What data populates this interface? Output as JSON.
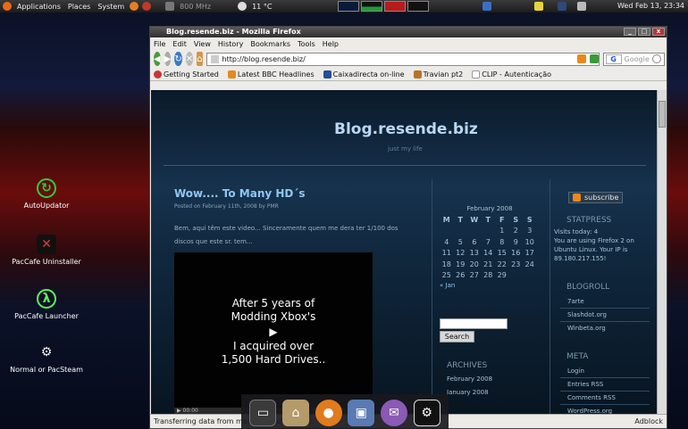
{
  "panel": {
    "applications": "Applications",
    "places": "Places",
    "system": "System",
    "cpu": "800 MHz",
    "temperature": "11 °C",
    "clock": "Wed Feb 13, 23:34"
  },
  "desktop": {
    "icons": [
      {
        "label": "AutoUpdator",
        "icon": "autoupdator-icon"
      },
      {
        "label": "PacCafe Uninstaller",
        "icon": "pacman-uninstall-icon"
      },
      {
        "label": "PacCafe Launcher",
        "icon": "lambda-launcher-icon"
      },
      {
        "label": "Normal or PacSteam",
        "icon": "steam-icon"
      }
    ]
  },
  "window": {
    "title": "Blog.resende.biz - Mozilla Firefox",
    "menu": [
      "File",
      "Edit",
      "View",
      "History",
      "Bookmarks",
      "Tools",
      "Help"
    ],
    "url": "http://blog.resende.biz/",
    "search_placeholder": "Google",
    "bookmarks": [
      "Getting Started",
      "Latest BBC Headlines",
      "Caixadirecta on-line",
      "Travian pt2",
      "CLIP - Autenticação"
    ],
    "status": "Transferring data from media.youtube.com...",
    "adblock": "Adblock"
  },
  "blog": {
    "title": "Blog.resende.biz",
    "tagline": "just my life",
    "post": {
      "title": "Wow.... To Many HD´s",
      "meta": "Posted on February 11th, 2008 by PMR",
      "body": "Bem, aqui têm este video... Sinceramente quem me dera ter 1/100 dos discos que este sr. tem...",
      "video_lines": [
        "After 5 years of",
        "Modding Xbox's",
        "I acquired over",
        "1,500 Hard Drives.."
      ],
      "video_controls": "00:00"
    },
    "calendar": {
      "caption": "February 2008",
      "headers": [
        "M",
        "T",
        "W",
        "T",
        "F",
        "S",
        "S"
      ],
      "rows": [
        [
          "",
          "",
          "",
          "",
          "1",
          "2",
          "3"
        ],
        [
          "4",
          "5",
          "6",
          "7",
          "8",
          "9",
          "10"
        ],
        [
          "11",
          "12",
          "13",
          "14",
          "15",
          "16",
          "17"
        ],
        [
          "18",
          "19",
          "20",
          "21",
          "22",
          "23",
          "24"
        ],
        [
          "25",
          "26",
          "27",
          "28",
          "29",
          "",
          ""
        ]
      ],
      "prev": "« Jan"
    },
    "search_button": "Search",
    "archives": {
      "heading": "ARCHIVES",
      "items": [
        "February 2008",
        "January 2008"
      ]
    },
    "subscribe": "subscribe",
    "statpress": {
      "heading": "STATPRESS",
      "lines": [
        "Visits today: 4",
        "You are using Firefox 2 on Ubuntu Linux. Your IP is 89.180.217.155!"
      ]
    },
    "blogroll": {
      "heading": "BLOGROLL",
      "items": [
        "7arte",
        "Slashdot.org",
        "Winbeta.org"
      ]
    },
    "meta": {
      "heading": "META",
      "items": [
        "Login",
        "Entries RSS",
        "Comments RSS",
        "WordPress.org"
      ]
    }
  }
}
